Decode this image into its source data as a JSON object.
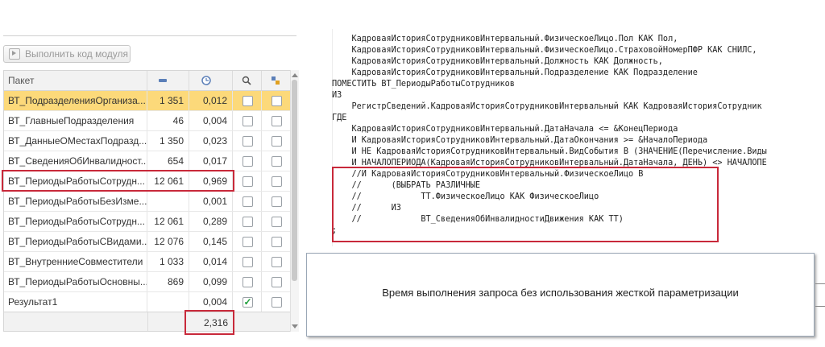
{
  "toolbar": {
    "execute_label": "Выполнить код модуля"
  },
  "table": {
    "headers": {
      "name": "Пакет"
    },
    "rows": [
      {
        "name": "ВТ_ПодразделенияОрганиза...",
        "count": "1 351",
        "time": "0,012",
        "checked": false
      },
      {
        "name": "ВТ_ГлавныеПодразделения",
        "count": "46",
        "time": "0,004",
        "checked": false
      },
      {
        "name": "ВТ_ДанныеОМестахПодразд...",
        "count": "1 350",
        "time": "0,023",
        "checked": false
      },
      {
        "name": "ВТ_СведенияОбИнвалидност...",
        "count": "654",
        "time": "0,017",
        "checked": false
      },
      {
        "name": "ВТ_ПериодыРаботыСотрудн...",
        "count": "12 061",
        "time": "0,969",
        "checked": false
      },
      {
        "name": "ВТ_ПериодыРаботыБезИзме...",
        "count": "",
        "time": "0,001",
        "checked": false
      },
      {
        "name": "ВТ_ПериодыРаботыСотрудн...",
        "count": "12 061",
        "time": "0,289",
        "checked": false
      },
      {
        "name": "ВТ_ПериодыРаботыСВидами...",
        "count": "12 076",
        "time": "0,145",
        "checked": false
      },
      {
        "name": "ВТ_ВнутренниеСовместители",
        "count": "1 033",
        "time": "0,014",
        "checked": false
      },
      {
        "name": "ВТ_ПериодыРаботыОсновны...",
        "count": "869",
        "time": "0,099",
        "checked": false
      },
      {
        "name": "Результат1",
        "count": "",
        "time": "0,004",
        "checked": true
      }
    ],
    "total_time": "2,316",
    "selected_row": 0
  },
  "code_lines": [
    "    КадроваяИсторияСотрудниковИнтервальный.ФизическоеЛицо.Пол КАК Пол,",
    "    КадроваяИсторияСотрудниковИнтервальный.ФизическоеЛицо.СтраховойНомерПФР КАК СНИЛС,",
    "    КадроваяИсторияСотрудниковИнтервальный.Должность КАК Должность,",
    "    КадроваяИсторияСотрудниковИнтервальный.Подразделение КАК Подразделение",
    "ПОМЕСТИТЬ ВТ_ПериодыРаботыСотрудников",
    "ИЗ",
    "    РегистрСведений.КадроваяИсторияСотрудниковИнтервальный КАК КадроваяИсторияСотрудник",
    "ГДЕ",
    "    КадроваяИсторияСотрудниковИнтервальный.ДатаНачала <= &КонецПериода",
    "    И КадроваяИсторияСотрудниковИнтервальный.ДатаОкончания >= &НачалоПериода",
    "    И НЕ КадроваяИсторияСотрудниковИнтервальный.ВидСобытия В (ЗНАЧЕНИЕ(Перечисление.Виды",
    "    И НАЧАЛОПЕРИОДА(КадроваяИсторияСотрудниковИнтервальный.ДатаНачала, ДЕНЬ) <> НАЧАЛОПЕ",
    "    //И КадроваяИсторияСотрудниковИнтервальный.ФизическоеЛицо В",
    "    //      (ВЫБРАТЬ РАЗЛИЧНЫЕ",
    "    //            ТТ.ФизическоеЛицо КАК ФизическоеЛицо",
    "    //      ИЗ",
    "    //            ВТ_СведенияОбИнвалидностиДвижения КАК ТТ)",
    ";"
  ],
  "message": "Время выполнения запроса без использования жесткой параметризации",
  "colors": {
    "selected_row": "#fcd97a",
    "highlight_box": "#c8293a",
    "checkmark": "#1e9e3a"
  },
  "icons": {
    "col_count": "rows-icon",
    "col_time": "clock-icon",
    "col_search": "magnifier-icon",
    "col_props": "temp-table-icon"
  }
}
